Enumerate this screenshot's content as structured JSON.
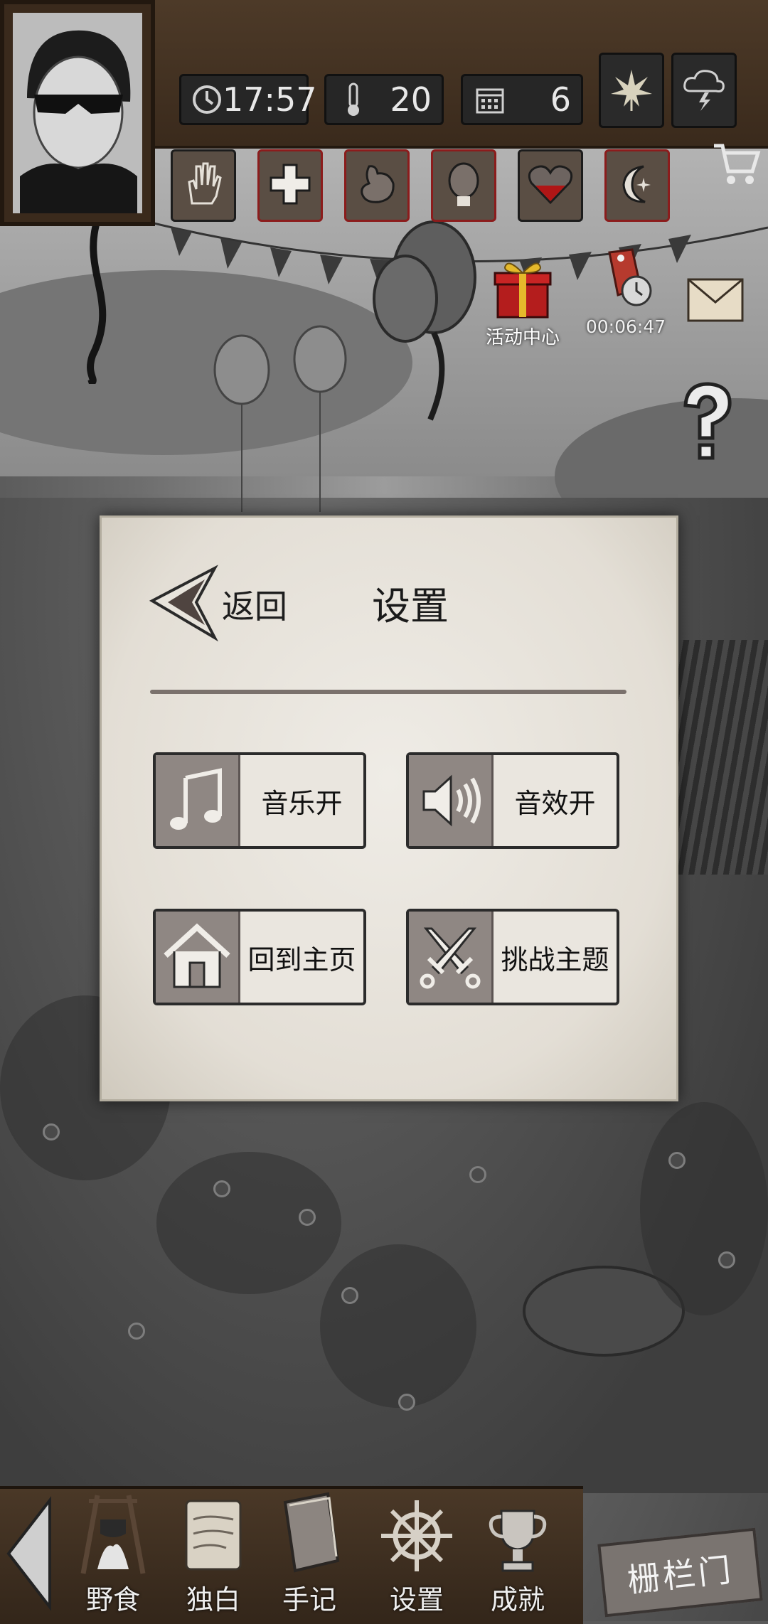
{
  "hud": {
    "time": "17:57",
    "temperature": "20",
    "day": "6",
    "icons": {
      "clock": "clock-icon",
      "temperature": "thermometer-icon",
      "calendar": "calendar-icon",
      "season": "leaf-icon",
      "weather": "thunderstorm-icon"
    },
    "status_icons": [
      "hand-icon",
      "health-icon",
      "stomach-icon",
      "mind-icon",
      "heart-icon",
      "sleep-icon"
    ]
  },
  "floaters": {
    "event_center_label": "活动中心",
    "timer_label": "00:06:47"
  },
  "settings": {
    "back_label": "返回",
    "title": "设置",
    "options": [
      {
        "label": "音乐开",
        "icon": "music-note-icon"
      },
      {
        "label": "音效开",
        "icon": "speaker-icon"
      },
      {
        "label": "回到主页",
        "icon": "home-icon"
      },
      {
        "label": "挑战主题",
        "icon": "crossed-swords-icon"
      }
    ]
  },
  "bottom_nav": {
    "items": [
      {
        "label": "野食",
        "icon": "campfire-icon"
      },
      {
        "label": "独白",
        "icon": "scroll-icon"
      },
      {
        "label": "手记",
        "icon": "journal-icon"
      },
      {
        "label": "设置",
        "icon": "ship-wheel-icon"
      },
      {
        "label": "成就",
        "icon": "trophy-icon"
      }
    ],
    "location_sign": "栅栏门"
  },
  "colors": {
    "panel_bg": "#e9e5de",
    "wood": "#3f2f21",
    "status_red_border": "#8b1c1c"
  }
}
